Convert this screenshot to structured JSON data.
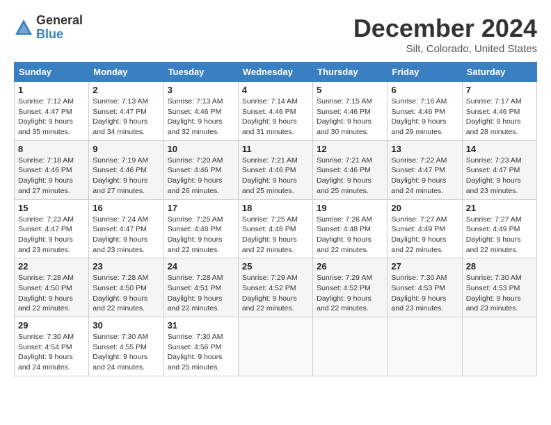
{
  "header": {
    "logo_general": "General",
    "logo_blue": "Blue",
    "month_title": "December 2024",
    "location": "Silt, Colorado, United States"
  },
  "days_of_week": [
    "Sunday",
    "Monday",
    "Tuesday",
    "Wednesday",
    "Thursday",
    "Friday",
    "Saturday"
  ],
  "weeks": [
    [
      {
        "day": "1",
        "info": "Sunrise: 7:12 AM\nSunset: 4:47 PM\nDaylight: 9 hours\nand 35 minutes."
      },
      {
        "day": "2",
        "info": "Sunrise: 7:13 AM\nSunset: 4:47 PM\nDaylight: 9 hours\nand 34 minutes."
      },
      {
        "day": "3",
        "info": "Sunrise: 7:13 AM\nSunset: 4:46 PM\nDaylight: 9 hours\nand 32 minutes."
      },
      {
        "day": "4",
        "info": "Sunrise: 7:14 AM\nSunset: 4:46 PM\nDaylight: 9 hours\nand 31 minutes."
      },
      {
        "day": "5",
        "info": "Sunrise: 7:15 AM\nSunset: 4:46 PM\nDaylight: 9 hours\nand 30 minutes."
      },
      {
        "day": "6",
        "info": "Sunrise: 7:16 AM\nSunset: 4:46 PM\nDaylight: 9 hours\nand 29 minutes."
      },
      {
        "day": "7",
        "info": "Sunrise: 7:17 AM\nSunset: 4:46 PM\nDaylight: 9 hours\nand 28 minutes."
      }
    ],
    [
      {
        "day": "8",
        "info": "Sunrise: 7:18 AM\nSunset: 4:46 PM\nDaylight: 9 hours\nand 27 minutes."
      },
      {
        "day": "9",
        "info": "Sunrise: 7:19 AM\nSunset: 4:46 PM\nDaylight: 9 hours\nand 27 minutes."
      },
      {
        "day": "10",
        "info": "Sunrise: 7:20 AM\nSunset: 4:46 PM\nDaylight: 9 hours\nand 26 minutes."
      },
      {
        "day": "11",
        "info": "Sunrise: 7:21 AM\nSunset: 4:46 PM\nDaylight: 9 hours\nand 25 minutes."
      },
      {
        "day": "12",
        "info": "Sunrise: 7:21 AM\nSunset: 4:46 PM\nDaylight: 9 hours\nand 25 minutes."
      },
      {
        "day": "13",
        "info": "Sunrise: 7:22 AM\nSunset: 4:47 PM\nDaylight: 9 hours\nand 24 minutes."
      },
      {
        "day": "14",
        "info": "Sunrise: 7:23 AM\nSunset: 4:47 PM\nDaylight: 9 hours\nand 23 minutes."
      }
    ],
    [
      {
        "day": "15",
        "info": "Sunrise: 7:23 AM\nSunset: 4:47 PM\nDaylight: 9 hours\nand 23 minutes."
      },
      {
        "day": "16",
        "info": "Sunrise: 7:24 AM\nSunset: 4:47 PM\nDaylight: 9 hours\nand 23 minutes."
      },
      {
        "day": "17",
        "info": "Sunrise: 7:25 AM\nSunset: 4:48 PM\nDaylight: 9 hours\nand 22 minutes."
      },
      {
        "day": "18",
        "info": "Sunrise: 7:25 AM\nSunset: 4:48 PM\nDaylight: 9 hours\nand 22 minutes."
      },
      {
        "day": "19",
        "info": "Sunrise: 7:26 AM\nSunset: 4:48 PM\nDaylight: 9 hours\nand 22 minutes."
      },
      {
        "day": "20",
        "info": "Sunrise: 7:27 AM\nSunset: 4:49 PM\nDaylight: 9 hours\nand 22 minutes."
      },
      {
        "day": "21",
        "info": "Sunrise: 7:27 AM\nSunset: 4:49 PM\nDaylight: 9 hours\nand 22 minutes."
      }
    ],
    [
      {
        "day": "22",
        "info": "Sunrise: 7:28 AM\nSunset: 4:50 PM\nDaylight: 9 hours\nand 22 minutes."
      },
      {
        "day": "23",
        "info": "Sunrise: 7:28 AM\nSunset: 4:50 PM\nDaylight: 9 hours\nand 22 minutes."
      },
      {
        "day": "24",
        "info": "Sunrise: 7:28 AM\nSunset: 4:51 PM\nDaylight: 9 hours\nand 22 minutes."
      },
      {
        "day": "25",
        "info": "Sunrise: 7:29 AM\nSunset: 4:52 PM\nDaylight: 9 hours\nand 22 minutes."
      },
      {
        "day": "26",
        "info": "Sunrise: 7:29 AM\nSunset: 4:52 PM\nDaylight: 9 hours\nand 22 minutes."
      },
      {
        "day": "27",
        "info": "Sunrise: 7:30 AM\nSunset: 4:53 PM\nDaylight: 9 hours\nand 23 minutes."
      },
      {
        "day": "28",
        "info": "Sunrise: 7:30 AM\nSunset: 4:53 PM\nDaylight: 9 hours\nand 23 minutes."
      }
    ],
    [
      {
        "day": "29",
        "info": "Sunrise: 7:30 AM\nSunset: 4:54 PM\nDaylight: 9 hours\nand 24 minutes."
      },
      {
        "day": "30",
        "info": "Sunrise: 7:30 AM\nSunset: 4:55 PM\nDaylight: 9 hours\nand 24 minutes."
      },
      {
        "day": "31",
        "info": "Sunrise: 7:30 AM\nSunset: 4:56 PM\nDaylight: 9 hours\nand 25 minutes."
      },
      {
        "day": "",
        "info": ""
      },
      {
        "day": "",
        "info": ""
      },
      {
        "day": "",
        "info": ""
      },
      {
        "day": "",
        "info": ""
      }
    ]
  ]
}
